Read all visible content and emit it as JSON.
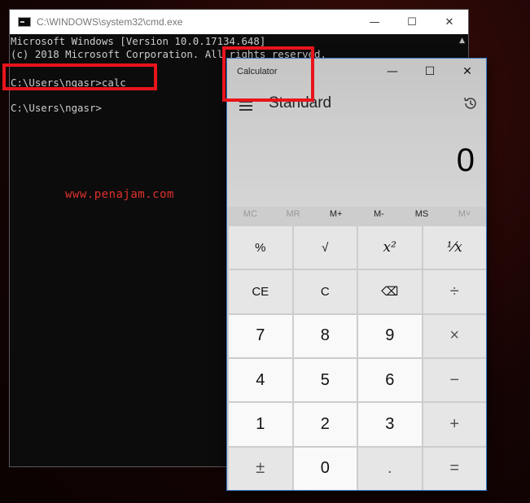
{
  "cmd": {
    "title": "C:\\WINDOWS\\system32\\cmd.exe",
    "lines": [
      "Microsoft Windows [Version 10.0.17134.648]",
      "(c) 2018 Microsoft Corporation. All rights reserved.",
      "",
      "C:\\Users\\ngasr>calc",
      "",
      "C:\\Users\\ngasr>"
    ],
    "controls": {
      "minimize": "—",
      "maximize": "☐",
      "close": "✕"
    }
  },
  "watermark": "www.penajam.com",
  "calculator": {
    "title": "Calculator",
    "mode": "Standard",
    "display": "0",
    "controls": {
      "minimize": "—",
      "maximize": "☐",
      "close": "✕"
    },
    "memory": [
      "MC",
      "MR",
      "M+",
      "M-",
      "MS",
      "M˅"
    ],
    "keys": [
      {
        "label": "%",
        "kind": "fn"
      },
      {
        "label": "√",
        "kind": "fn"
      },
      {
        "label": "x²",
        "kind": "fn-serif"
      },
      {
        "label": "¹⁄x",
        "kind": "fn-serif"
      },
      {
        "label": "CE",
        "kind": "fn"
      },
      {
        "label": "C",
        "kind": "fn"
      },
      {
        "label": "⌫",
        "kind": "fn"
      },
      {
        "label": "÷",
        "kind": "op"
      },
      {
        "label": "7",
        "kind": "num"
      },
      {
        "label": "8",
        "kind": "num"
      },
      {
        "label": "9",
        "kind": "num"
      },
      {
        "label": "×",
        "kind": "op"
      },
      {
        "label": "4",
        "kind": "num"
      },
      {
        "label": "5",
        "kind": "num"
      },
      {
        "label": "6",
        "kind": "num"
      },
      {
        "label": "−",
        "kind": "op"
      },
      {
        "label": "1",
        "kind": "num"
      },
      {
        "label": "2",
        "kind": "num"
      },
      {
        "label": "3",
        "kind": "num"
      },
      {
        "label": "+",
        "kind": "op"
      },
      {
        "label": "±",
        "kind": "op"
      },
      {
        "label": "0",
        "kind": "num"
      },
      {
        "label": ".",
        "kind": "op"
      },
      {
        "label": "=",
        "kind": "eq"
      }
    ]
  },
  "accent_colors": {
    "highlight_box": "#e8141c",
    "window_border": "#3c7bc6"
  }
}
